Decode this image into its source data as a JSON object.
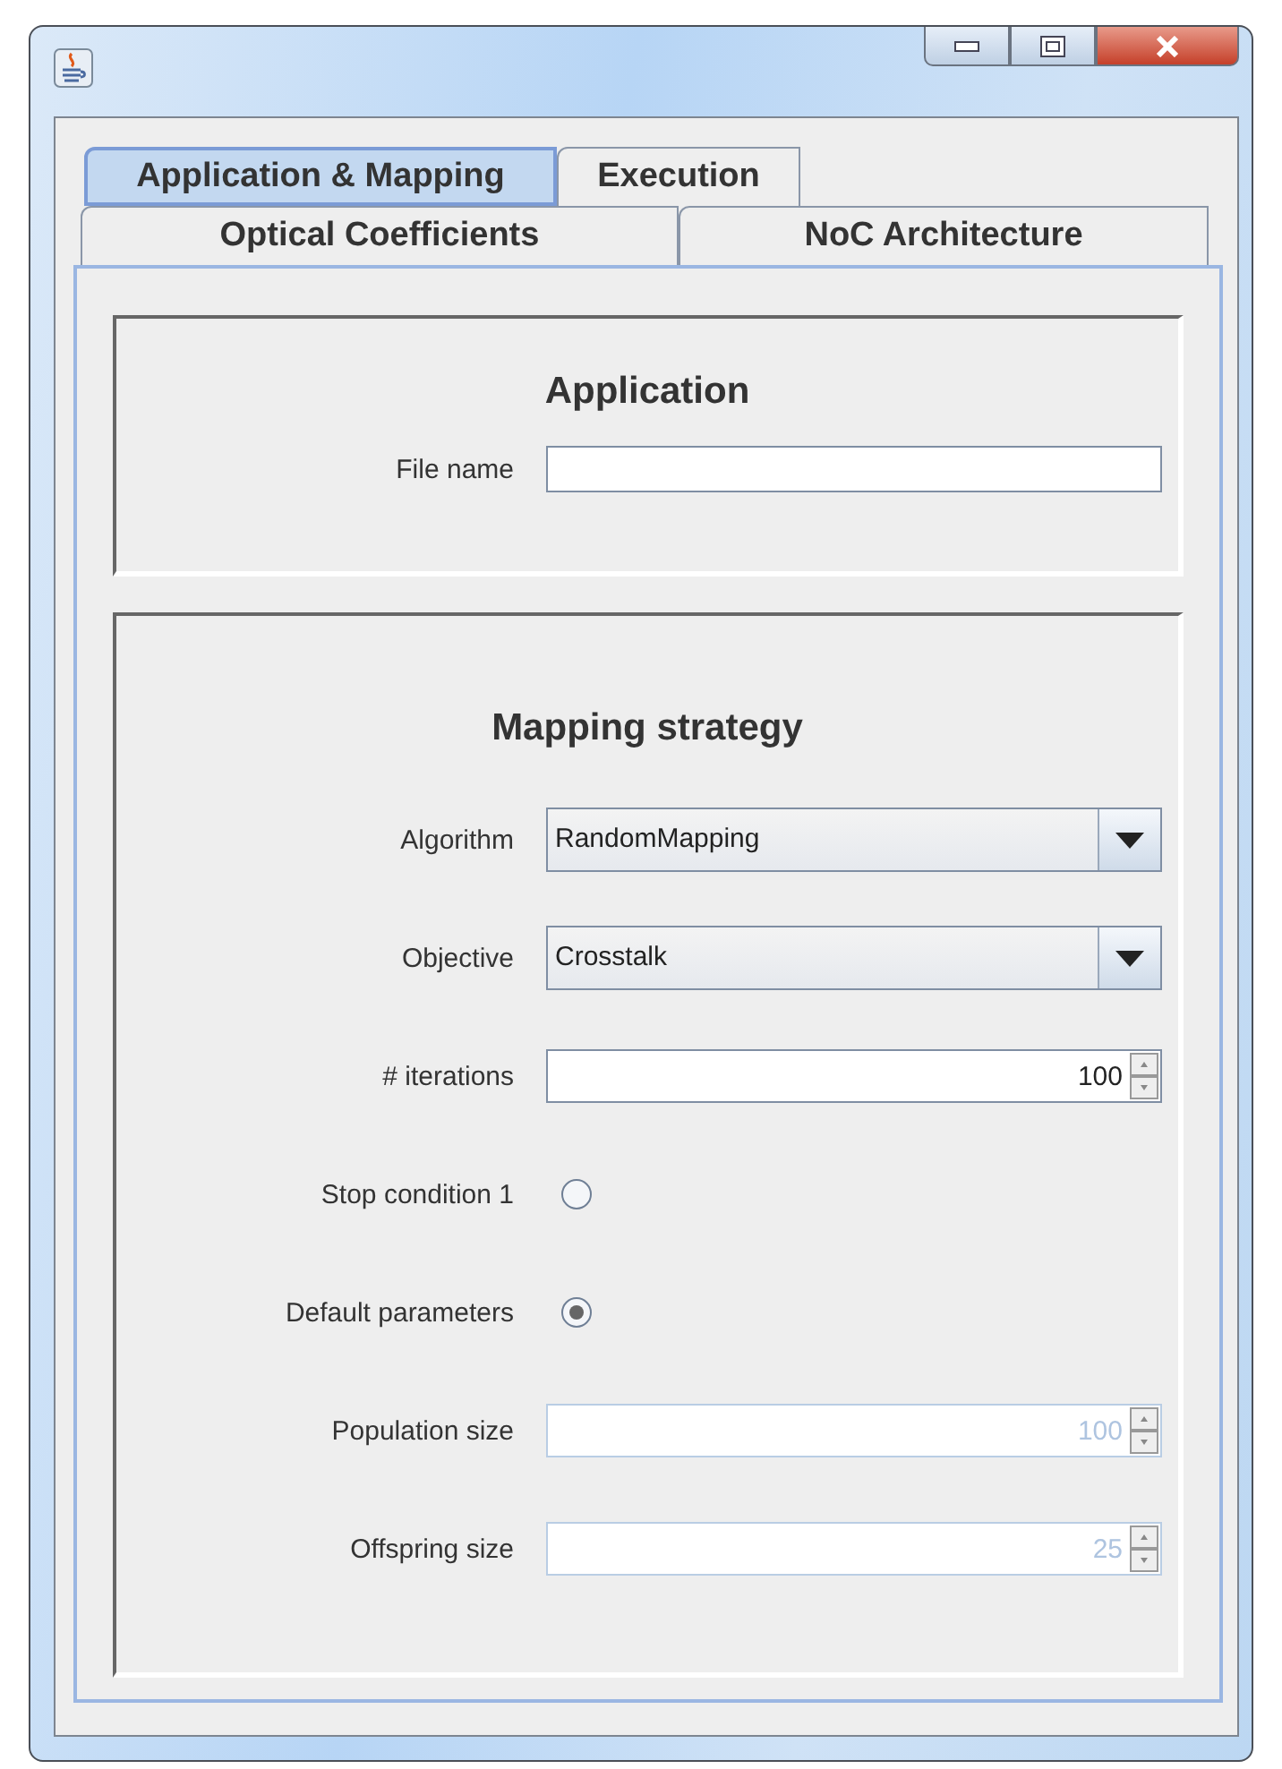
{
  "tab_rows": [
    {
      "tabs": [
        {
          "label": "Application & Mapping",
          "selected": true
        },
        {
          "label": "Execution",
          "selected": false
        }
      ]
    },
    {
      "tabs": [
        {
          "label": "Optical Coefficients",
          "selected": false
        },
        {
          "label": "NoC Architecture",
          "selected": false
        }
      ]
    }
  ],
  "sections": [
    {
      "title": "Application",
      "fields": [
        {
          "kind": "text",
          "label": "File name"
        }
      ]
    },
    {
      "title": "Mapping strategy",
      "fields": [
        {
          "kind": "combo",
          "label": "Algorithm",
          "value": "RandomMapping"
        },
        {
          "kind": "combo",
          "label": "Objective",
          "value": "Crosstalk"
        },
        {
          "kind": "spinner",
          "label": "# iterations",
          "value": "100",
          "disabled": false
        },
        {
          "kind": "radio",
          "label": "Stop condition 1",
          "selected": false
        },
        {
          "kind": "radio",
          "label": "Default parameters",
          "selected": true
        },
        {
          "kind": "spinner",
          "label": "Population size",
          "value": "100",
          "disabled": true
        },
        {
          "kind": "spinner",
          "label": "Offspring size",
          "value": "25",
          "disabled": true
        }
      ]
    }
  ]
}
